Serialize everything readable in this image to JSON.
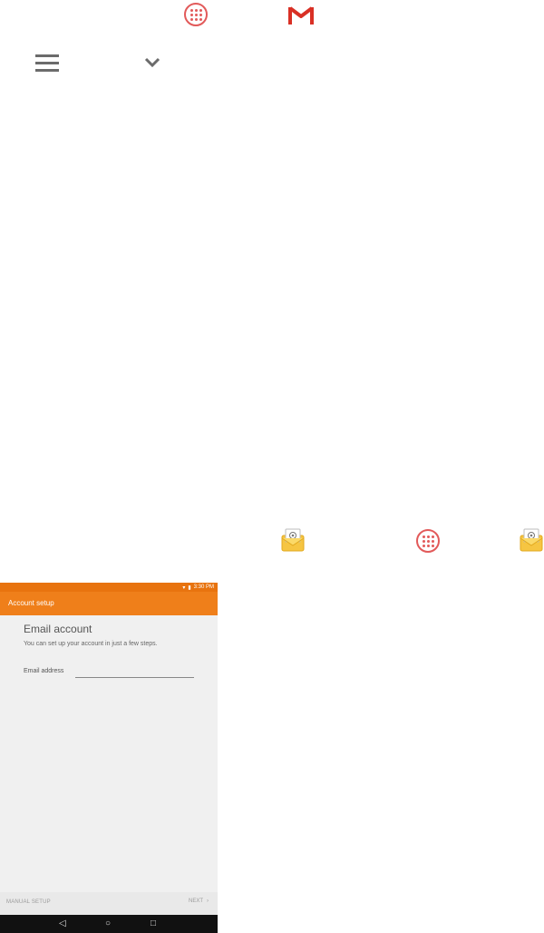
{
  "icons": {
    "apps_launcher": "apps-launcher-icon",
    "gmail": "gmail-icon",
    "menu": "menu-icon",
    "chevron": "chevron-down-icon",
    "email_app": "email-app-icon"
  },
  "phone": {
    "status": {
      "time": "3:30 PM"
    },
    "appbar": {
      "title": "Account setup"
    },
    "content": {
      "heading": "Email account",
      "subtitle": "You can set up your account in just a few steps.",
      "email_label": "Email address",
      "email_value": ""
    },
    "footer": {
      "manual_setup": "MANUAL SETUP",
      "next": "NEXT",
      "next_chevron": "›"
    },
    "nav": {
      "back": "◁",
      "home": "○",
      "recents": "□"
    }
  },
  "colors": {
    "accent_orange": "#ef7f1a",
    "gmail_red": "#d93025"
  }
}
